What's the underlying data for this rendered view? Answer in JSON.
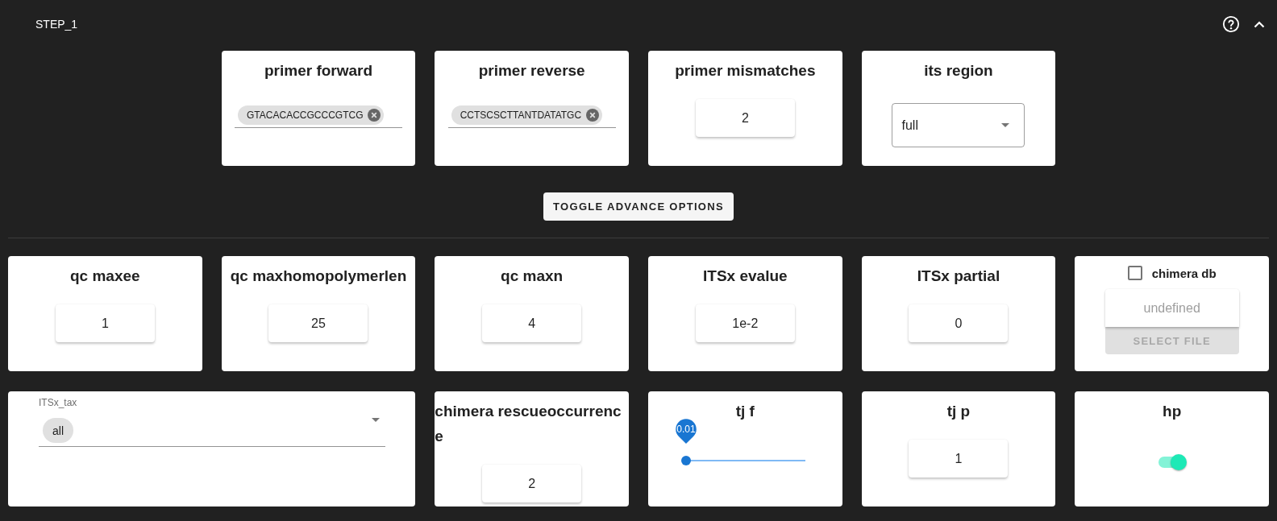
{
  "header": {
    "title": "STEP_1"
  },
  "main_options": [
    {
      "kind": "chips",
      "title": "primer forward",
      "chips": [
        "GTACACACCGCCCGTCG"
      ]
    },
    {
      "kind": "chips",
      "title": "primer reverse",
      "chips": [
        "CCTSCSCTTANTDATATGC"
      ]
    },
    {
      "kind": "number",
      "title": "primer mismatches",
      "value": "2"
    },
    {
      "kind": "select",
      "title": "its region",
      "value": "full"
    }
  ],
  "toggle_button": {
    "label": "TOGGLE ADVANCE OPTIONS"
  },
  "advanced_options": [
    {
      "kind": "number",
      "title": "qc maxee",
      "value": "1"
    },
    {
      "kind": "number",
      "title": "qc maxhomopolymerlen",
      "value": "25"
    },
    {
      "kind": "number",
      "title": "qc maxn",
      "value": "4"
    },
    {
      "kind": "number",
      "title": "ITSx evalue",
      "value": "1e-2"
    },
    {
      "kind": "number",
      "title": "ITSx partial",
      "value": "0"
    },
    {
      "kind": "file",
      "label": "chimera db",
      "checked": false,
      "placeholder": "undefined",
      "button": {
        "label": "SELECT FILE",
        "disabled": true
      }
    },
    {
      "kind": "chip_select",
      "label": "ITSx_tax",
      "chips": [
        "all"
      ]
    },
    {
      "kind": "number",
      "title": "chimera rescueoccurrence",
      "value": "2"
    },
    {
      "kind": "slider",
      "title": "tj f",
      "level": 0,
      "reading": "0.01"
    },
    {
      "kind": "number",
      "title": "tj p",
      "value": "1"
    },
    {
      "kind": "switch",
      "title": "hp",
      "on": true
    }
  ]
}
